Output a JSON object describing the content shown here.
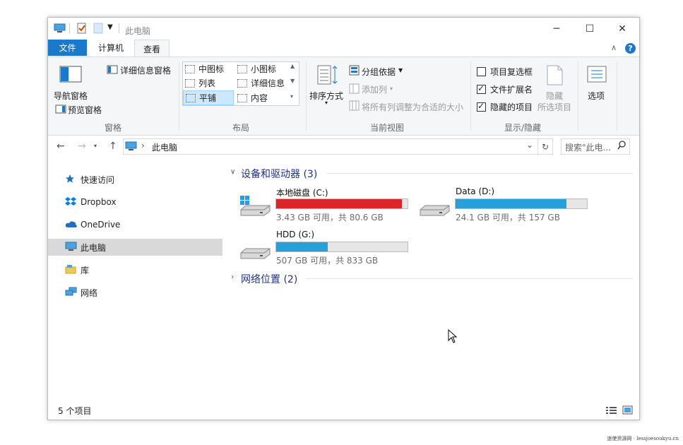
{
  "window": {
    "title": "此电脑",
    "minimize_icon": "─",
    "maximize_icon": "☐",
    "close_icon": "✕"
  },
  "tabs": {
    "file": "文件",
    "computer": "计算机",
    "view": "查看"
  },
  "ribbon": {
    "panes": {
      "nav_pane": "导航窗格",
      "preview_pane": "预览窗格",
      "details_pane": "详细信息窗格",
      "group_label": "窗格"
    },
    "layout": {
      "items": [
        "中图标",
        "小图标",
        "列表",
        "详细信息",
        "平铺",
        "内容"
      ],
      "selected": "平铺",
      "group_label": "布局"
    },
    "current_view": {
      "sort_by": "排序方式",
      "group_by": "分组依据",
      "add_column": "添加列",
      "fit_columns": "将所有列调整为合适的大小",
      "group_label": "当前视图"
    },
    "show_hide": {
      "item_checkboxes": "项目复选框",
      "item_checkboxes_checked": false,
      "file_extensions": "文件扩展名",
      "file_extensions_checked": true,
      "hidden_items": "隐藏的项目",
      "hidden_items_checked": true,
      "hide_selected_1": "隐藏",
      "hide_selected_2": "所选项目",
      "group_label": "显示/隐藏"
    },
    "options": "选项"
  },
  "address": {
    "path": "此电脑",
    "separator": "›",
    "search_placeholder": "搜索\"此电...",
    "back": "←",
    "forward": "→",
    "up": "↑",
    "refresh": "↻",
    "dropdown": "⌄"
  },
  "nav": {
    "items": [
      {
        "label": "快速访问",
        "icon": "star-icon"
      },
      {
        "label": "Dropbox",
        "icon": "dropbox-icon"
      },
      {
        "label": "OneDrive",
        "icon": "cloud-icon"
      },
      {
        "label": "此电脑",
        "icon": "computer-icon",
        "selected": true
      },
      {
        "label": "库",
        "icon": "library-icon"
      },
      {
        "label": "网络",
        "icon": "network-icon"
      }
    ]
  },
  "content": {
    "devices_group": "设备和驱动器 (3)",
    "network_group": "网络位置 (2)",
    "drives": [
      {
        "name": "本地磁盘 (C:)",
        "info": "3.43 GB 可用，共 80.6 GB",
        "used_fraction": 0.957,
        "bar_color": "#da2626"
      },
      {
        "name": "Data (D:)",
        "info": "24.1 GB 可用，共 157 GB",
        "used_fraction": 0.846,
        "bar_color": "#26a0da"
      },
      {
        "name": "HDD (G:)",
        "info": "507 GB 可用，共 833 GB",
        "used_fraction": 0.391,
        "bar_color": "#26a0da"
      }
    ]
  },
  "status": {
    "count": "5 个项目"
  },
  "watermark": "迷使资源网 · lessjoesoukyu.cn",
  "colors": {
    "accent": "#1979ca",
    "selected_bg": "#cce8ff"
  }
}
